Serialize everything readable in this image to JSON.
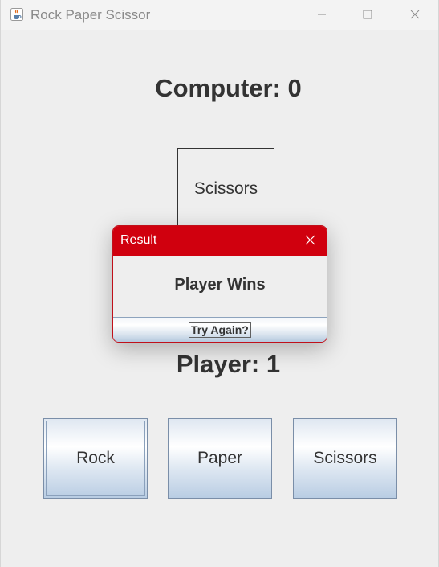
{
  "window": {
    "title": "Rock Paper Scissor",
    "icon": "java-cup-icon",
    "controls": [
      "minimize-icon",
      "maximize-icon",
      "close-icon"
    ]
  },
  "game": {
    "computer_score_label": "Computer: 0",
    "computer_choice": "Scissors",
    "player_score_label": "Player: 1",
    "choices": [
      "Rock",
      "Paper",
      "Scissors"
    ]
  },
  "dialog": {
    "title": "Result",
    "message": "Player Wins",
    "button_label": "Try Again?"
  },
  "colors": {
    "dialog_titlebar": "#d0000e",
    "background": "#eeeeee",
    "text": "#333333"
  }
}
